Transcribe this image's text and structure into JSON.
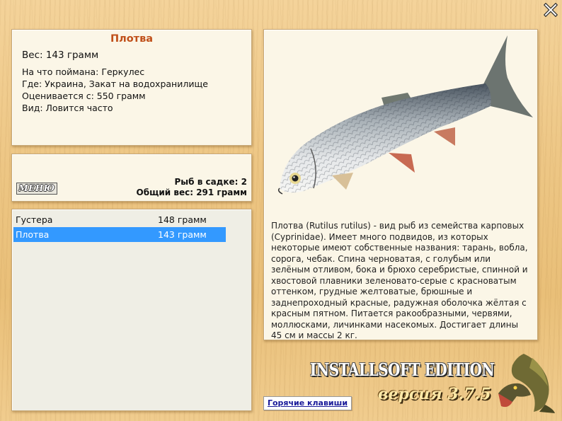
{
  "fish_info": {
    "title": "Плотва",
    "weight": "Вес: 143 грамм",
    "bait": "На что поймана: Геркулес",
    "location": "Где: Украина, Закат на водохранилище",
    "value": "Оценивается с: 550 грамм",
    "kind": "Вид: Ловится часто"
  },
  "cage": {
    "menu_label": "МЕНЮ",
    "count": "Рыб в садке: 2",
    "total": "Общий вес: 291 грамм"
  },
  "catch_list": [
    {
      "name": "Густера",
      "weight": "148 грамм"
    },
    {
      "name": "Плотва",
      "weight": "143 грамм"
    }
  ],
  "description": "Плотва (Rutilus rutilus) - вид рыб из семейства карповых (Cyprinidae). Имеет много подвидов, из которых некоторые имеют собственные названия: тарань, вобла, сорога, чебак. Спина черноватая, с голубым или зелёным отливом, бока и брюхо серебристые, спинной и хвостовой плавники зеленовато-серые с красноватым оттенком, грудные желтоватые, брюшные и заднепроходный красные, радужная оболочка жёлтая с красным пятном. Питается ракообразными, червями, моллюсками, личинками насекомых. Достигает длины 45 см и массы 2 кг.",
  "brand": {
    "title": "INSTALLSOFT EDITION",
    "version": "версия 3.7.5"
  },
  "hotkeys_label": "Горячие клавиши",
  "icons": {
    "close": "close-icon",
    "fish": "roach-fish-image",
    "logo": "pike-logo-icon"
  },
  "colors": {
    "title": "#c0501a",
    "selection": "#3399ff",
    "link": "#1a1a99"
  }
}
